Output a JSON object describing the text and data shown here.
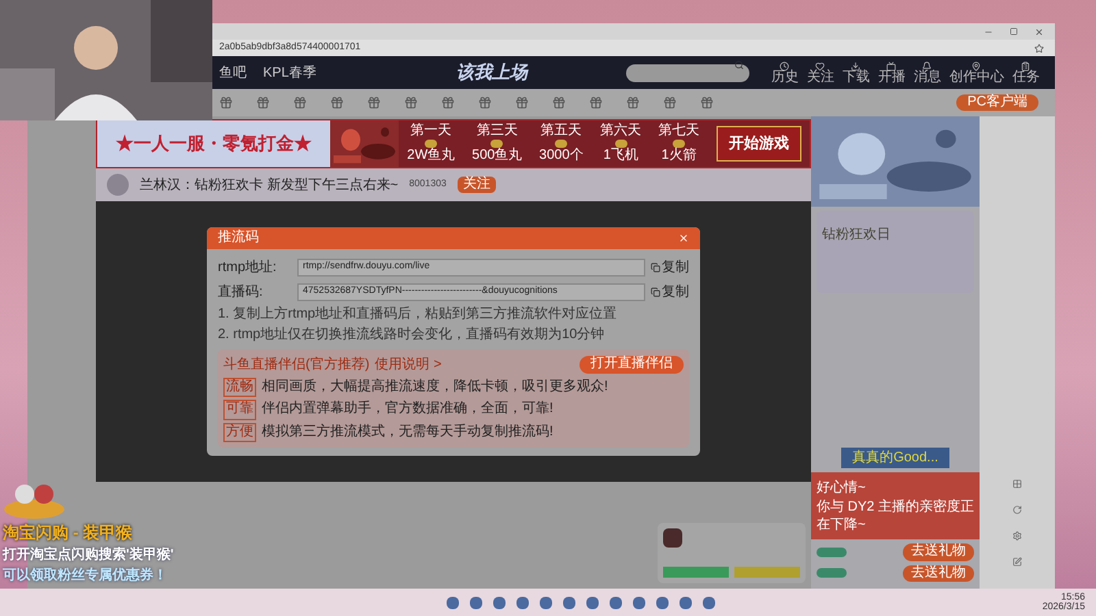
{
  "browser": {
    "url": "2a0b5ab9dbf3a8d574400001701"
  },
  "nav": {
    "links": [
      "鱼吧",
      "KPL春季"
    ],
    "logo": "该我上场",
    "actions": [
      {
        "label": "历史",
        "kind": "clock"
      },
      {
        "label": "关注",
        "kind": "heart"
      },
      {
        "label": "下载",
        "kind": "download"
      },
      {
        "label": "开播",
        "kind": "tv"
      },
      {
        "label": "消息",
        "kind": "bell"
      },
      {
        "label": "创作中心",
        "kind": "pin"
      },
      {
        "label": "任务",
        "kind": "clipboard"
      }
    ]
  },
  "toolbar": {
    "pc_button": "PC客户端"
  },
  "banner": {
    "slogan": "★一人一服・零氪打金★",
    "days": [
      {
        "day": "第一天",
        "reward": "2W鱼丸"
      },
      {
        "day": "第三天",
        "reward": "500鱼丸"
      },
      {
        "day": "第五天",
        "reward": "3000个"
      },
      {
        "day": "第六天",
        "reward": "1飞机"
      },
      {
        "day": "第七天",
        "reward": "1火箭"
      }
    ],
    "cta": "开始游戏"
  },
  "streamer": {
    "title": "兰林汉：钻粉狂欢卡 新发型下午三点右来~",
    "room": "8001303",
    "follow": "关注"
  },
  "dialog": {
    "title": "推流码",
    "rows": [
      {
        "label": "rtmp地址:",
        "value": "rtmp://sendfrw.douyu.com/live",
        "copy": "复制"
      },
      {
        "label": "直播码:",
        "value": "4752532687YSDTyfPN-------------------------&douyucognitions",
        "copy": "复制"
      }
    ],
    "notes": [
      "1. 复制上方rtmp地址和直播码后，粘贴到第三方推流软件对应位置",
      "2. rtmp地址仅在切换推流线路时会变化，直播码有效期为10分钟"
    ],
    "promo": {
      "title": "斗鱼直播伴侣(官方推荐)",
      "link": "使用说明 >",
      "button": "打开直播伴侣",
      "features": [
        {
          "tag": "流畅",
          "text": "相同画质，大幅提高推流速度，降低卡顿，吸引更多观众!"
        },
        {
          "tag": "可靠",
          "text": "伴侣内置弹幕助手，官方数据准确，全面，可靠!"
        },
        {
          "tag": "方便",
          "text": "模拟第三方推流模式，无需每天手动复制推流码!"
        }
      ]
    }
  },
  "chat": {
    "rank_title": "钻粉狂欢日",
    "popup_label": "真真的Good...",
    "notice": {
      "title": "好心情~",
      "text": "你与 DY2 主播的亲密度正在下降~"
    },
    "gifts": [
      {
        "button": "去送礼物"
      },
      {
        "button": "去送礼物"
      }
    ]
  },
  "overlay": {
    "title": "淘宝闪购 - 装甲猴",
    "line1": "打开淘宝点闪购搜索'装甲猴'",
    "line2": "可以领取粉丝专属优惠券！"
  },
  "taskbar": {
    "time": "15:56",
    "date": "2026/3/15"
  }
}
